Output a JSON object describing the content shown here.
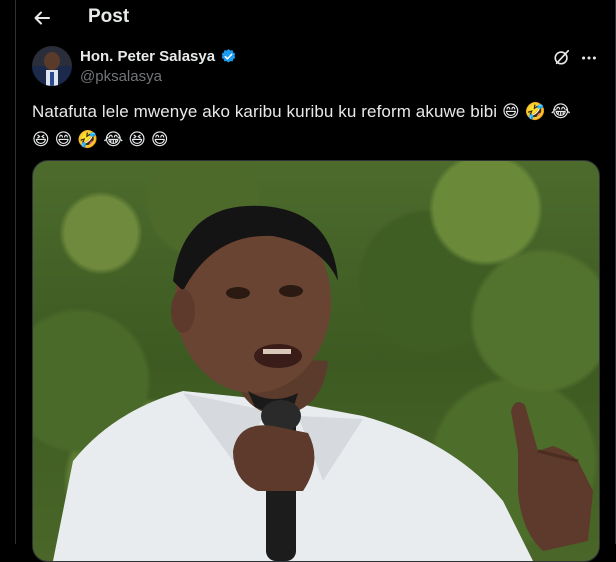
{
  "header": {
    "title": "Post"
  },
  "author": {
    "display_name": "Hon. Peter Salasya",
    "handle": "@pksalasya",
    "verified": true,
    "verified_color": "#1d9bf0"
  },
  "tweet": {
    "text": "Natafuta lele mwenye ako karibu kuribu ku reform akuwe bibi",
    "emojis_line1": [
      "😄",
      "🤣",
      "😂"
    ],
    "emojis_line2": [
      "😆",
      "😄",
      "🤣",
      "😂",
      "😆",
      "😄"
    ]
  },
  "icons": {
    "back": "arrow-left-icon",
    "grok": "grok-icon",
    "more": "more-horizontal-icon"
  },
  "colors": {
    "background": "#000000",
    "text": "#e7e9ea",
    "secondary_text": "#71767b",
    "divider": "#2f3336"
  }
}
